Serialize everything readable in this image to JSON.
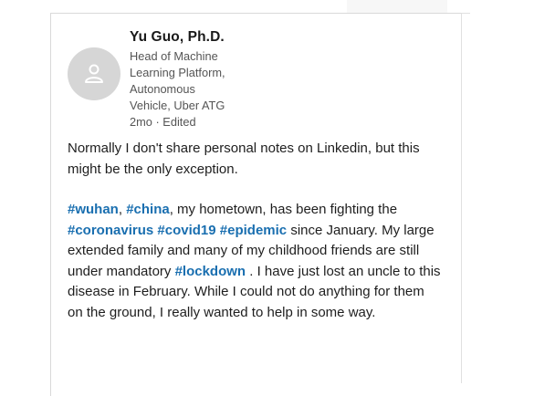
{
  "post": {
    "author": {
      "name": "Yu Guo, Ph.D.",
      "title_lines": [
        "Head of Machine",
        "Learning Platform,",
        "Autonomous",
        "Vehicle, Uber ATG"
      ],
      "avatar_icon": "default-person-icon"
    },
    "time": "2mo",
    "separator": "·",
    "edited": "Edited",
    "paragraph1": "Normally I don't share personal notes on Linkedin, but this might be the only exception.",
    "paragraph2": {
      "tag_wuhan": "#wuhan",
      "t1": ", ",
      "tag_china": "#china",
      "t2": ", my hometown, has been fighting the ",
      "tag_coronavirus": "#coronavirus",
      "t3": " ",
      "tag_covid19": "#covid19",
      "t4": " ",
      "tag_epidemic": "#epidemic",
      "t5": " since January. My large extended family and many of my childhood friends are still under mandatory ",
      "tag_lockdown": "#lockdown",
      "t6": " . I have just lost an uncle to this disease in February. While I could not do anything for them on the ground, I really wanted to help in some way."
    }
  },
  "colors": {
    "hashtag": "#1a6fb0",
    "avatar_bg": "#d6d6d6"
  }
}
